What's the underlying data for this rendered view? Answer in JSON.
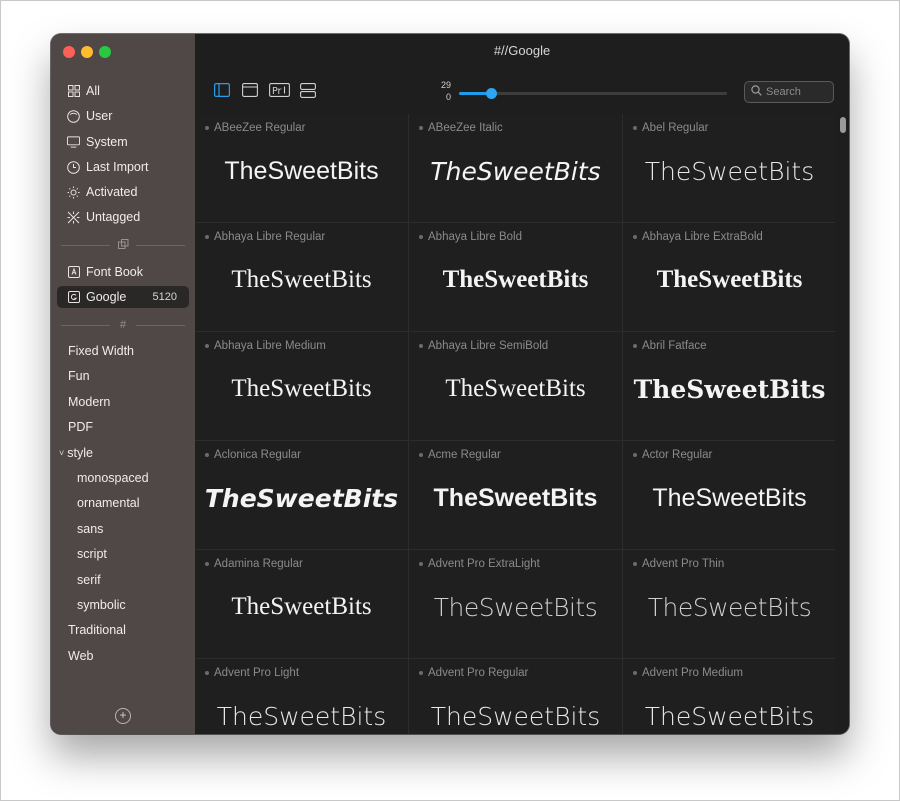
{
  "window": {
    "title": "#//Google"
  },
  "sidebar": {
    "sources": [
      {
        "label": "All",
        "icon": "grid-icon"
      },
      {
        "label": "User",
        "icon": "user-circle-icon"
      },
      {
        "label": "System",
        "icon": "monitor-icon"
      },
      {
        "label": "Last Import",
        "icon": "clock-icon"
      },
      {
        "label": "Activated",
        "icon": "sun-icon"
      },
      {
        "label": "Untagged",
        "icon": "untagged-icon"
      }
    ],
    "collections": [
      {
        "label": "Font Book",
        "icon": "font-book-icon",
        "count": ""
      },
      {
        "label": "Google",
        "icon": "google-icon",
        "count": "5120",
        "selected": true
      }
    ],
    "tags": [
      {
        "label": "Fixed Width"
      },
      {
        "label": "Fun"
      },
      {
        "label": "Modern"
      },
      {
        "label": "PDF"
      },
      {
        "label": "style",
        "expanded": true
      },
      {
        "label": "monospaced",
        "child": true
      },
      {
        "label": "ornamental",
        "child": true
      },
      {
        "label": "sans",
        "child": true
      },
      {
        "label": "script",
        "child": true
      },
      {
        "label": "serif",
        "child": true
      },
      {
        "label": "symbolic",
        "child": true
      },
      {
        "label": "Traditional"
      },
      {
        "label": "Web"
      }
    ]
  },
  "toolbar": {
    "views": [
      "sidebar-toggle-icon",
      "window-icon",
      "preview-text-icon",
      "split-view-icon"
    ],
    "size_value": "29",
    "size_min": "0",
    "size_fraction": 0.12,
    "search_placeholder": "Search"
  },
  "sample_text": "TheSweetBits",
  "fonts": [
    {
      "name": "ABeeZee Regular",
      "style": "sans"
    },
    {
      "name": "ABeeZee Italic",
      "style": "sans-italic"
    },
    {
      "name": "Abel Regular",
      "style": "sans-narrow"
    },
    {
      "name": "Abhaya Libre Regular",
      "style": "serif"
    },
    {
      "name": "Abhaya Libre Bold",
      "style": "serif-bold"
    },
    {
      "name": "Abhaya Libre ExtraBold",
      "style": "serif-bold"
    },
    {
      "name": "Abhaya Libre Medium",
      "style": "serif"
    },
    {
      "name": "Abhaya Libre SemiBold",
      "style": "serif"
    },
    {
      "name": "Abril Fatface",
      "style": "serif-black"
    },
    {
      "name": "Aclonica Regular",
      "style": "display"
    },
    {
      "name": "Acme Regular",
      "style": "sans-bold"
    },
    {
      "name": "Actor Regular",
      "style": "sans"
    },
    {
      "name": "Adamina Regular",
      "style": "serif"
    },
    {
      "name": "Advent Pro ExtraLight",
      "style": "thin"
    },
    {
      "name": "Advent Pro Thin",
      "style": "thin"
    },
    {
      "name": "Advent Pro Light",
      "style": "light"
    },
    {
      "name": "Advent Pro Regular",
      "style": "light"
    },
    {
      "name": "Advent Pro Medium",
      "style": "sans-narrow"
    }
  ]
}
